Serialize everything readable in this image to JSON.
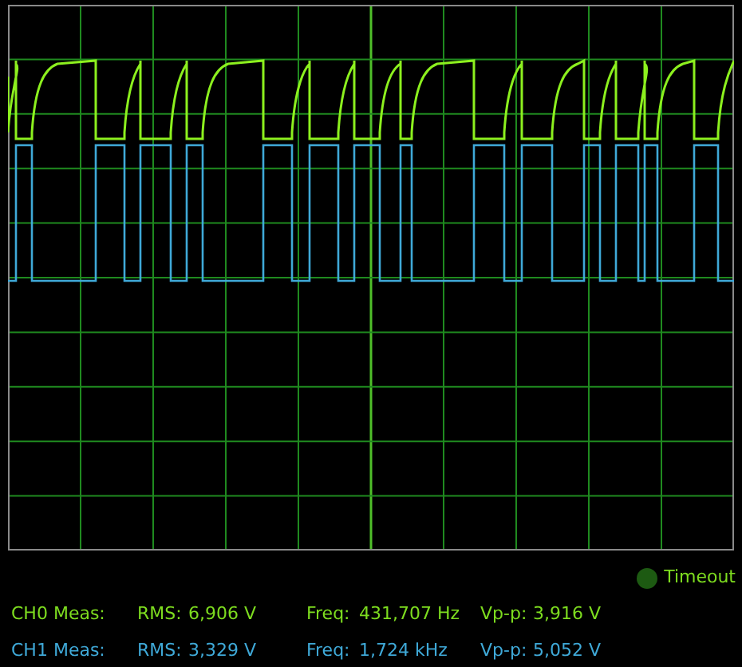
{
  "status": {
    "label": "Timeout",
    "lit": false
  },
  "measurements": [
    {
      "channel": "CH0 Meas:",
      "color": "#7ddc1f",
      "rms_label": "RMS:",
      "rms": "6,906 V",
      "freq_label": "Freq:",
      "freq": "431,707 Hz",
      "vpp_label": "Vp-p:",
      "vpp": "3,916 V"
    },
    {
      "channel": "CH1 Meas:",
      "color": "#3fa9d8",
      "rms_label": "RMS:",
      "rms": "3,329 V",
      "freq_label": "Freq:",
      "freq": "1,724 kHz",
      "vpp_label": "Vp-p:",
      "vpp": "5,052 V"
    }
  ]
}
